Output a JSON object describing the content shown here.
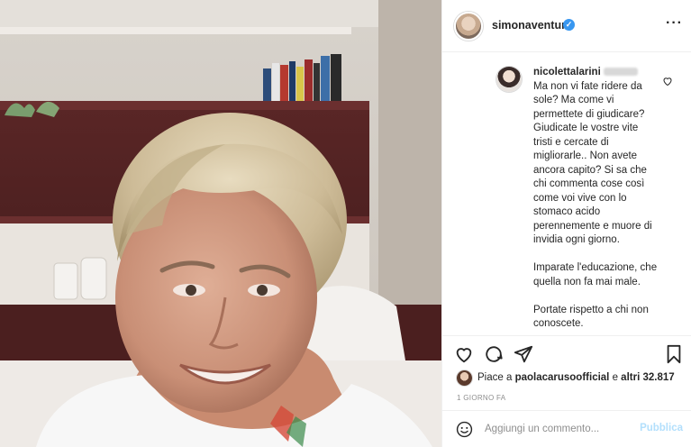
{
  "post": {
    "username": "simonaventura",
    "verified_icon": "verified-badge-icon",
    "more_icon": "more-options-icon"
  },
  "comment": {
    "username": "nicolettalarini",
    "paragraphs": [
      "Ma non vi fate ridere da sole? Ma come vi permettete di giudicare? Giudicate le vostre vite tristi e cercate di migliorarle.. Non avete ancora capito? Si sa che chi commenta cose così come voi vive con lo stomaco acido perennemente e muore di invidia ogni giorno.",
      "Imparate l'educazione, che quella non fa mai male.",
      "Portate rispetto a chi non conoscete."
    ]
  },
  "actions": {
    "icons": [
      "heart-icon",
      "comment-icon",
      "share-icon",
      "bookmark-icon"
    ]
  },
  "likes": {
    "prefix": "Piace a ",
    "user": "paolacarusoofficial",
    "middle": " e ",
    "others": "altri 32.817"
  },
  "timestamp": "1 GIORNO FA",
  "add_comment": {
    "placeholder": "Aggiungi un commento...",
    "publish_label": "Pubblica"
  },
  "colors": {
    "accent": "#3897f0",
    "publish_disabled": "#b2dffc",
    "border": "#efefef",
    "muted": "#8e8e8e"
  }
}
